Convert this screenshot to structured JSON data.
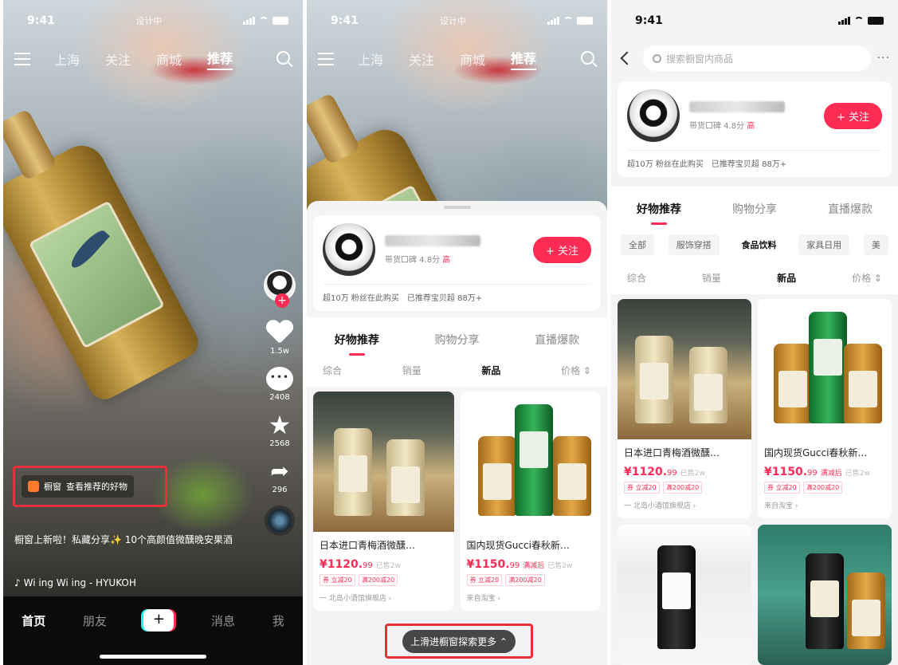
{
  "colors": {
    "accent": "#fe2c55",
    "highlight_border": "#e8303b",
    "dark_bar": "#0b0b0b"
  },
  "status": {
    "time": "9:41",
    "center": "设计中"
  },
  "video": {
    "top_tabs": [
      "上海",
      "关注",
      "商城",
      "推荐"
    ],
    "active_tab": "推荐",
    "side": {
      "likes": "1.5w",
      "comments": "2408",
      "favorites": "2568",
      "shares": "296"
    },
    "shop_chip": {
      "name": "橱窗",
      "text": "查看推荐的好物"
    },
    "caption": "橱窗上新啦！私藏分享✨ 10个高颜值微醺晚安果酒",
    "music": "Wi ing Wi ing - HYUKOH",
    "bottom_tabs": {
      "home": "首页",
      "friends": "朋友",
      "plus": "+",
      "messages": "消息",
      "me": "我"
    }
  },
  "shop": {
    "rating_label": "带货口碑 4.8分",
    "rating_level": "高",
    "follow": "+ 关注",
    "stat1": "超10万 粉丝在此购买",
    "stat2": "已推荐宝贝超 88万+",
    "tabs": [
      "好物推荐",
      "购物分享",
      "直播爆款"
    ],
    "categories": [
      "全部",
      "服饰穿搭",
      "食品饮料",
      "家具日用",
      "美"
    ],
    "active_category": "食品饮料",
    "sorts": [
      "综合",
      "销量",
      "新品",
      "价格 ⇕"
    ],
    "active_sort": "新品",
    "explore_btn": "上滑进橱窗探索更多 ⌃",
    "search_placeholder": "搜索橱窗内商品"
  },
  "products": [
    {
      "title": "日本进口青梅酒微醺…",
      "price": "¥1120.",
      "price_dec": "99",
      "sold": "已售2w",
      "tags": [
        "券 立减20",
        "满200减20"
      ],
      "from": "一 北岛小酒馆旗舰店 ›"
    },
    {
      "title": "国内现货Gucci春秋新…",
      "price": "¥1150.",
      "price_dec": "99",
      "sold": "已售2w",
      "badge": "满减后",
      "tags": [
        "券 立减20",
        "满200减20"
      ],
      "from": "来自淘宝 ›"
    }
  ]
}
